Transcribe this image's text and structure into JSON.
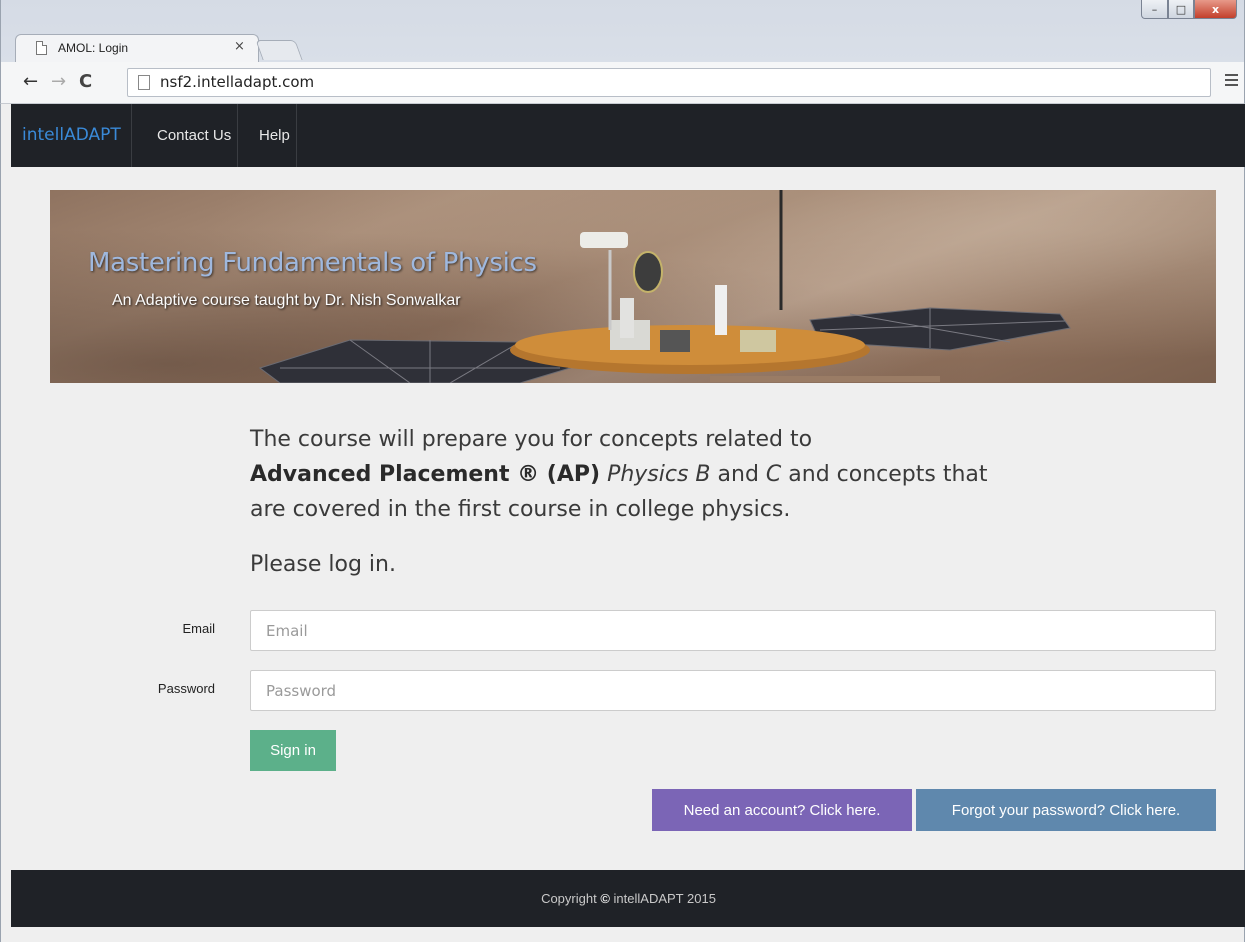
{
  "browser": {
    "tab_title": "AMOL: Login",
    "tab_close": "×",
    "url": "nsf2.intelladapt.com",
    "back_icon": "←",
    "forward_icon": "→",
    "reload_icon": "C",
    "window_controls": {
      "minimize": "–",
      "maximize": "□",
      "close": "x"
    }
  },
  "navbar": {
    "brand": "intellADAPT",
    "links": [
      {
        "label": "Contact Us"
      },
      {
        "label": "Help"
      }
    ],
    "brand_color": "#3a8ad8",
    "background": "#1f2227"
  },
  "banner": {
    "title": "Mastering Fundamentals of Physics",
    "subtitle": "An Adaptive course taught by Dr. Nish Sonwalkar"
  },
  "intro": {
    "line1": "The course will prepare you for concepts related to",
    "bold": "Advanced Placement ® (AP)",
    "italic_b": "Physics B",
    "and1": " and ",
    "italic_c": "C",
    "rest": " and concepts that are covered in the first course in college physics.",
    "prompt": "Please log in."
  },
  "form": {
    "email_label": "Email",
    "email_placeholder": "Email",
    "email_value": "",
    "password_label": "Password",
    "password_placeholder": "Password",
    "password_value": "",
    "signin_label": "Sign in",
    "signin_color": "#5cb08a"
  },
  "links": {
    "account_label": "Need an account? Click here.",
    "account_color": "#7b65b6",
    "forgot_label": "Forgot your password? Click here.",
    "forgot_color": "#5f88ad"
  },
  "footer": {
    "prefix": "Copyright",
    "symbol": "©",
    "suffix": "intellADAPT 2015"
  }
}
